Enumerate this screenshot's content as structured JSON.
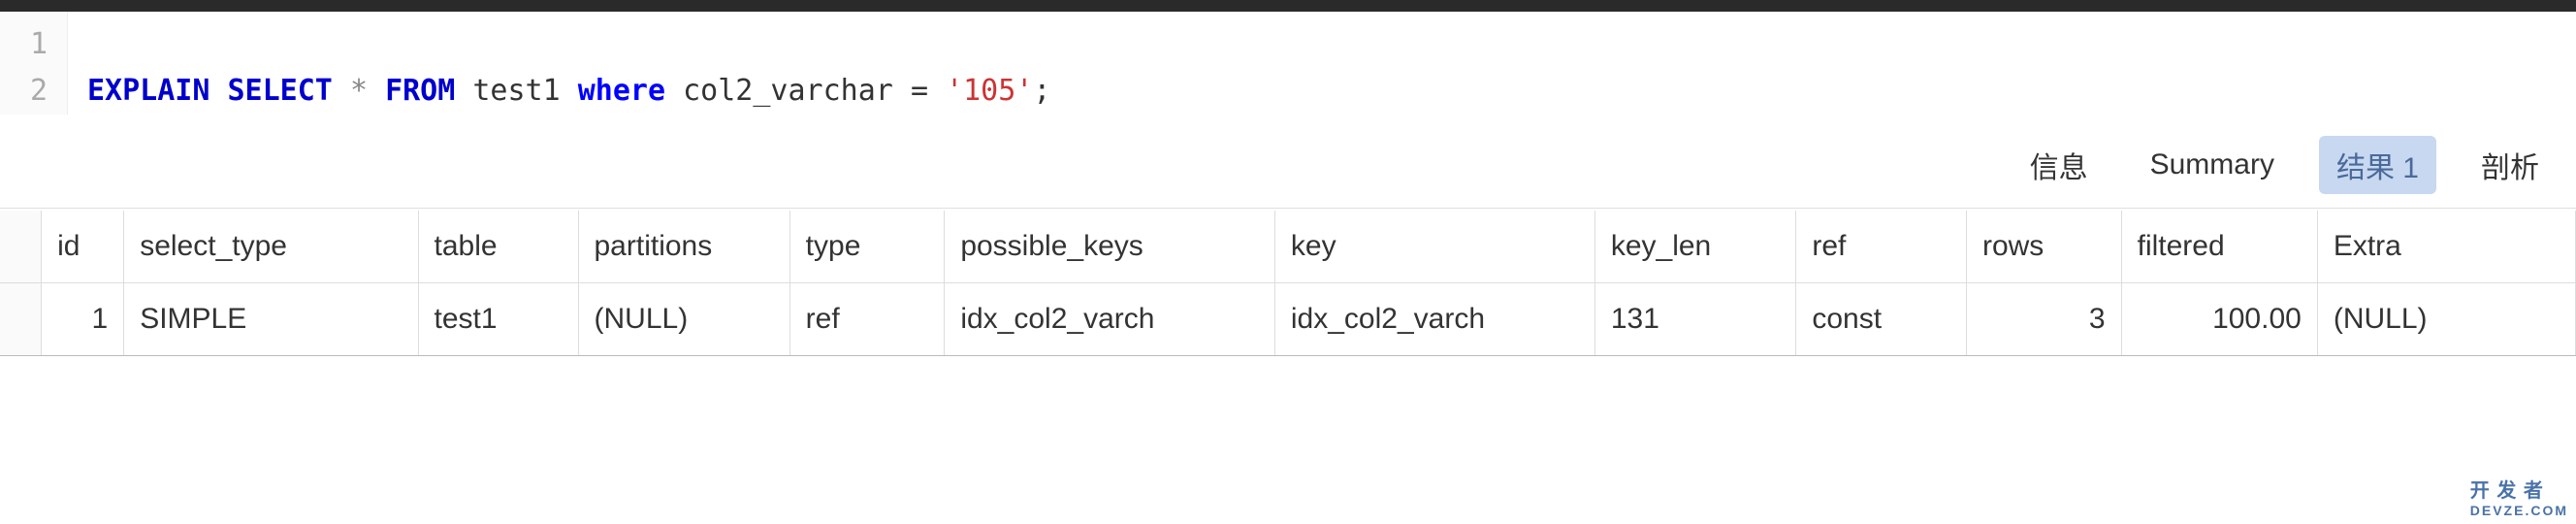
{
  "editor": {
    "lines": [
      {
        "num": "1",
        "tokens": []
      },
      {
        "num": "2",
        "tokens": [
          {
            "cls": "kw-bluebold",
            "text": "EXPLAIN"
          },
          {
            "cls": "",
            "text": " "
          },
          {
            "cls": "kw-bluebold",
            "text": "SELECT"
          },
          {
            "cls": "",
            "text": " "
          },
          {
            "cls": "star",
            "text": "*"
          },
          {
            "cls": "",
            "text": " "
          },
          {
            "cls": "kw-bluebold",
            "text": "FROM"
          },
          {
            "cls": "",
            "text": " "
          },
          {
            "cls": "ident",
            "text": "test1"
          },
          {
            "cls": "",
            "text": " "
          },
          {
            "cls": "kw-blue",
            "text": "where"
          },
          {
            "cls": "",
            "text": " "
          },
          {
            "cls": "ident",
            "text": "col2_varchar "
          },
          {
            "cls": "punct",
            "text": "="
          },
          {
            "cls": "",
            "text": " "
          },
          {
            "cls": "str",
            "text": "'105'"
          },
          {
            "cls": "punct",
            "text": ";"
          }
        ]
      }
    ]
  },
  "tabs": {
    "items": [
      {
        "label": "信息",
        "active": false
      },
      {
        "label": "Summary",
        "active": false
      },
      {
        "label": "结果 1",
        "active": true
      },
      {
        "label": "剖析",
        "active": false
      }
    ]
  },
  "results": {
    "columns": [
      "id",
      "select_type",
      "table",
      "partitions",
      "type",
      "possible_keys",
      "key",
      "key_len",
      "ref",
      "rows",
      "filtered",
      "Extra"
    ],
    "rows": [
      {
        "id": "1",
        "select_type": "SIMPLE",
        "table": "test1",
        "partitions": "(NULL)",
        "type": "ref",
        "possible_keys": "idx_col2_varch",
        "key": "idx_col2_varch",
        "key_len": "131",
        "ref": "const",
        "rows": "3",
        "filtered": "100.00",
        "Extra": "(NULL)"
      }
    ]
  },
  "watermark": {
    "main": "开 发 者",
    "sub": "DEVZE.COM"
  }
}
